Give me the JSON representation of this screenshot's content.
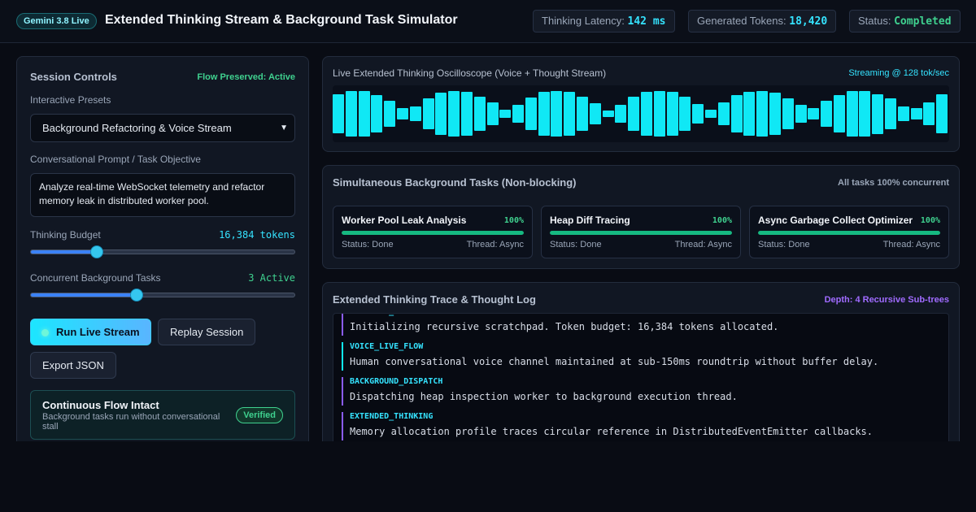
{
  "header": {
    "model_badge": "Gemini 3.8 Live",
    "title": "Extended Thinking Stream & Background Task Simulator",
    "stats": {
      "latency_label": "Thinking Latency:",
      "latency_value": "142 ms",
      "tokens_label": "Generated Tokens:",
      "tokens_value": "18,420",
      "status_label": "Status:",
      "status_value": "Completed"
    }
  },
  "session_controls": {
    "title": "Session Controls",
    "flow_status": "Flow Preserved: Active",
    "presets_label": "Interactive Presets",
    "preset_selected": "Background Refactoring & Voice Stream",
    "prompt_label": "Conversational Prompt / Task Objective",
    "prompt_value": "Analyze real-time WebSocket telemetry and refactor memory leak in distributed worker pool.",
    "budget_label": "Thinking Budget",
    "budget_value": "16,384 tokens",
    "budget_fraction": 0.25,
    "concurrent_label": "Concurrent Background Tasks",
    "concurrent_value": "3 Active",
    "concurrent_fraction": 0.4,
    "buttons": {
      "run": "Run Live Stream",
      "replay": "Replay Session",
      "export": "Export JSON"
    },
    "flow_card": {
      "title": "Continuous Flow Intact",
      "subtitle": "Background tasks run without conversational stall",
      "badge": "Verified"
    }
  },
  "oscilloscope": {
    "title": "Live Extended Thinking Oscilloscope (Voice + Thought Stream)",
    "rate": "Streaming @ 128 tok/sec",
    "bar_color": "#10e8f5",
    "levels": [
      0.68,
      0.81,
      0.81,
      0.65,
      0.45,
      0.19,
      0.27,
      0.54,
      0.73,
      0.81,
      0.78,
      0.6,
      0.41,
      0.14,
      0.32,
      0.57,
      0.76,
      0.81,
      0.76,
      0.6,
      0.38,
      0.11,
      0.32,
      0.6,
      0.76,
      0.81,
      0.78,
      0.59,
      0.35,
      0.14,
      0.4,
      0.65,
      0.78,
      0.81,
      0.73,
      0.54,
      0.32,
      0.19,
      0.45,
      0.65,
      0.81,
      0.81,
      0.7,
      0.54,
      0.27,
      0.19,
      0.4,
      0.68
    ]
  },
  "background_tasks": {
    "title": "Simultaneous Background Tasks (Non-blocking)",
    "summary": "All tasks 100% concurrent",
    "tasks": [
      {
        "name": "Worker Pool Leak Analysis",
        "percent": "100%",
        "progress": 1.0,
        "status": "Status: Done",
        "thread": "Thread: Async"
      },
      {
        "name": "Heap Diff Tracing",
        "percent": "100%",
        "progress": 1.0,
        "status": "Status: Done",
        "thread": "Thread: Async"
      },
      {
        "name": "Async Garbage Collect Optimizer",
        "percent": "100%",
        "progress": 1.0,
        "status": "Status: Done",
        "thread": "Thread: Async"
      }
    ]
  },
  "trace": {
    "title": "Extended Thinking Trace & Thought Log",
    "depth": "Depth: 4 Recursive Sub-trees",
    "entries": [
      {
        "kind": "EXTENDED_THINKING",
        "text": "Initializing recursive scratchpad. Token budget: 16,384 tokens allocated."
      },
      {
        "kind": "VOICE_LIVE_FLOW",
        "text": "Human conversational voice channel maintained at sub-150ms roundtrip without buffer delay."
      },
      {
        "kind": "BACKGROUND_DISPATCH",
        "text": "Dispatching heap inspection worker to background execution thread."
      },
      {
        "kind": "EXTENDED_THINKING",
        "text": "Memory allocation profile traces circular reference in DistributedEventEmitter callbacks."
      }
    ]
  },
  "colors": {
    "accent_cyan": "#35e3ff",
    "success_green": "#3fd18f",
    "purple": "#a06bff"
  }
}
